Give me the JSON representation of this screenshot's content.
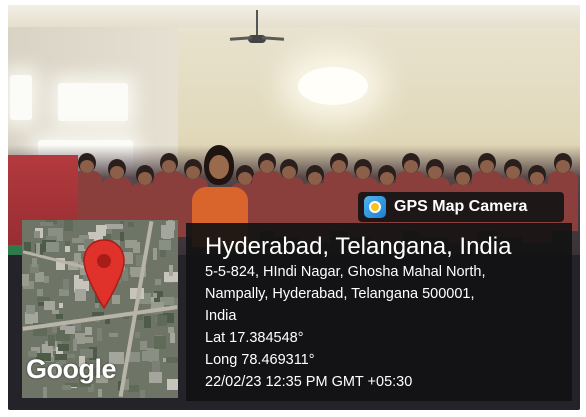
{
  "badge": {
    "app_name": "GPS Map Camera",
    "icon": "gps-map-camera-app-icon",
    "background_color": "#141416",
    "icon_color": "#1c7fd1"
  },
  "location": {
    "city_line": "Hyderabad, Telangana, India",
    "address_line1": "5-5-824, HIndi Nagar, Ghosha Mahal North,",
    "address_line2": "Nampally, Hyderabad, Telangana 500001,",
    "address_line3": "India",
    "latitude": "Lat 17.384548°",
    "longitude": "Long 78.469311°",
    "timestamp": "22/02/23 12:35 PM GMT +05:30"
  },
  "map": {
    "logo_text": "Google",
    "pin_icon": "map-pin-icon",
    "pin_color": "#e0322a"
  },
  "photo": {
    "scene_colors": {
      "wall": "#e2d9bb",
      "uniform": "#8a3f3c",
      "teacher_saree": "#d9652c"
    }
  }
}
